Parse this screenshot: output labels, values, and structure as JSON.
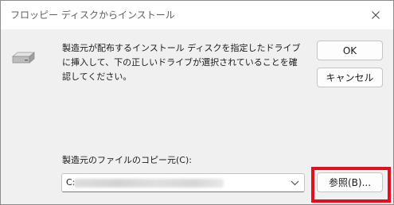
{
  "dialog": {
    "title": "フロッピー ディスクからインストール",
    "close_icon": "close-icon",
    "drive_icon": "floppy-drive-icon",
    "message": "製造元が配布するインストール ディスクを指定したドライブに挿入して、下の正しいドライブが選択されていることを確認してください。",
    "ok_label": "OK",
    "cancel_label": "キャンセル",
    "copy_from_label": "製造元のファイルのコピー元(C):",
    "copy_from_value": "C:",
    "browse_label": "参照(B)...",
    "highlight_color": "#e2101f",
    "accent_border": "#c4c4c4"
  }
}
